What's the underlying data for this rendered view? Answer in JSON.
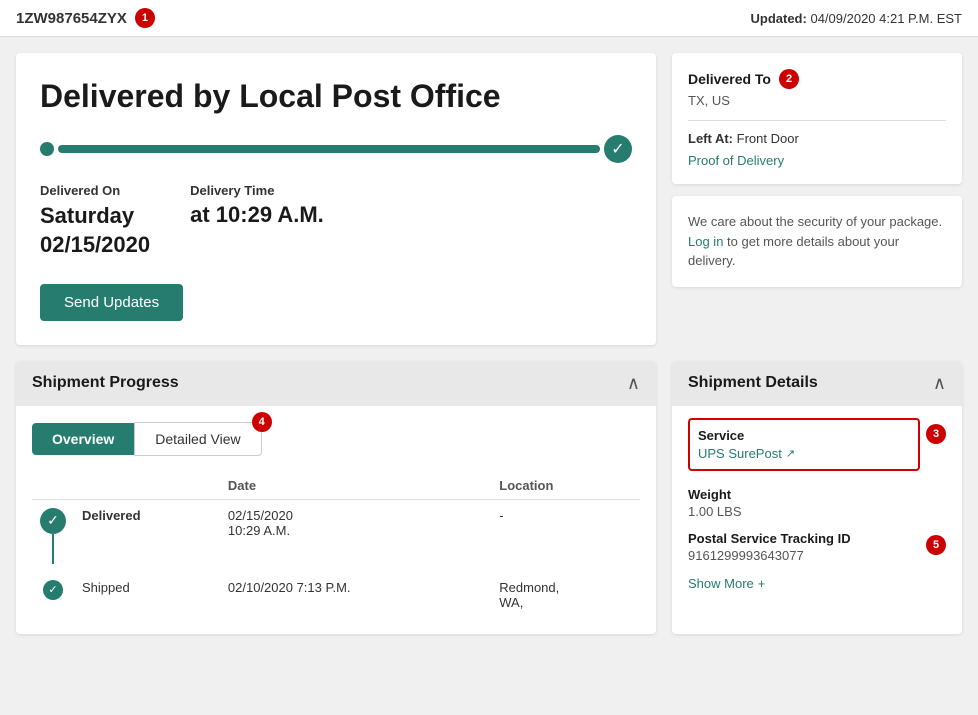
{
  "topBar": {
    "trackingId": "1ZW987654ZYX",
    "trackingBadge": "1",
    "updatedLabel": "Updated:",
    "updatedValue": "04/09/2020 4:21 P.M. EST"
  },
  "deliveryCard": {
    "title": "Delivered by Local Post Office",
    "deliveredOnLabel": "Delivered On",
    "deliveredOnValue": "Saturday\n02/15/2020",
    "deliveredOnLine1": "Saturday",
    "deliveredOnLine2": "02/15/2020",
    "deliveryTimeLabel": "Delivery Time",
    "deliveryTimeValue": "at 10:29 A.M.",
    "sendUpdatesLabel": "Send Updates"
  },
  "deliveredTo": {
    "label": "Delivered To",
    "badge": "2",
    "value": "TX, US",
    "leftAtLabel": "Left At:",
    "leftAtValue": "Front Door",
    "proofLink": "Proof of Delivery"
  },
  "securityCard": {
    "text": "We care about the security of your package.",
    "loginLink": "Log in",
    "text2": "to get more details about your delivery."
  },
  "shipmentProgress": {
    "title": "Shipment Progress",
    "tabs": {
      "overview": "Overview",
      "detailed": "Detailed View",
      "detailedBadge": "4"
    },
    "table": {
      "headers": [
        "",
        "",
        "Date",
        "Location"
      ],
      "rows": [
        {
          "status": "delivered",
          "statusLabel": "Delivered",
          "date": "02/15/2020\n10:29 A.M.",
          "dateLine1": "02/15/2020",
          "dateLine2": "10:29 A.M.",
          "location": "-"
        },
        {
          "status": "shipped",
          "statusLabel": "Shipped",
          "date": "02/10/2020  7:13 P.M.",
          "dateLine1": "02/10/2020  7:13 P.M.",
          "dateLine2": "",
          "location": "Redmond,\nWA,"
        }
      ]
    }
  },
  "shipmentDetails": {
    "title": "Shipment Details",
    "badge": "3",
    "service": {
      "label": "Service",
      "value": "UPS SurePost",
      "linkIcon": "↗"
    },
    "weight": {
      "label": "Weight",
      "value": "1.00 LBS"
    },
    "postalTracking": {
      "label": "Postal Service Tracking ID",
      "value": "9161299993643077"
    },
    "showMore": "Show More",
    "showMoreIcon": "+",
    "postalBadge": "5"
  }
}
